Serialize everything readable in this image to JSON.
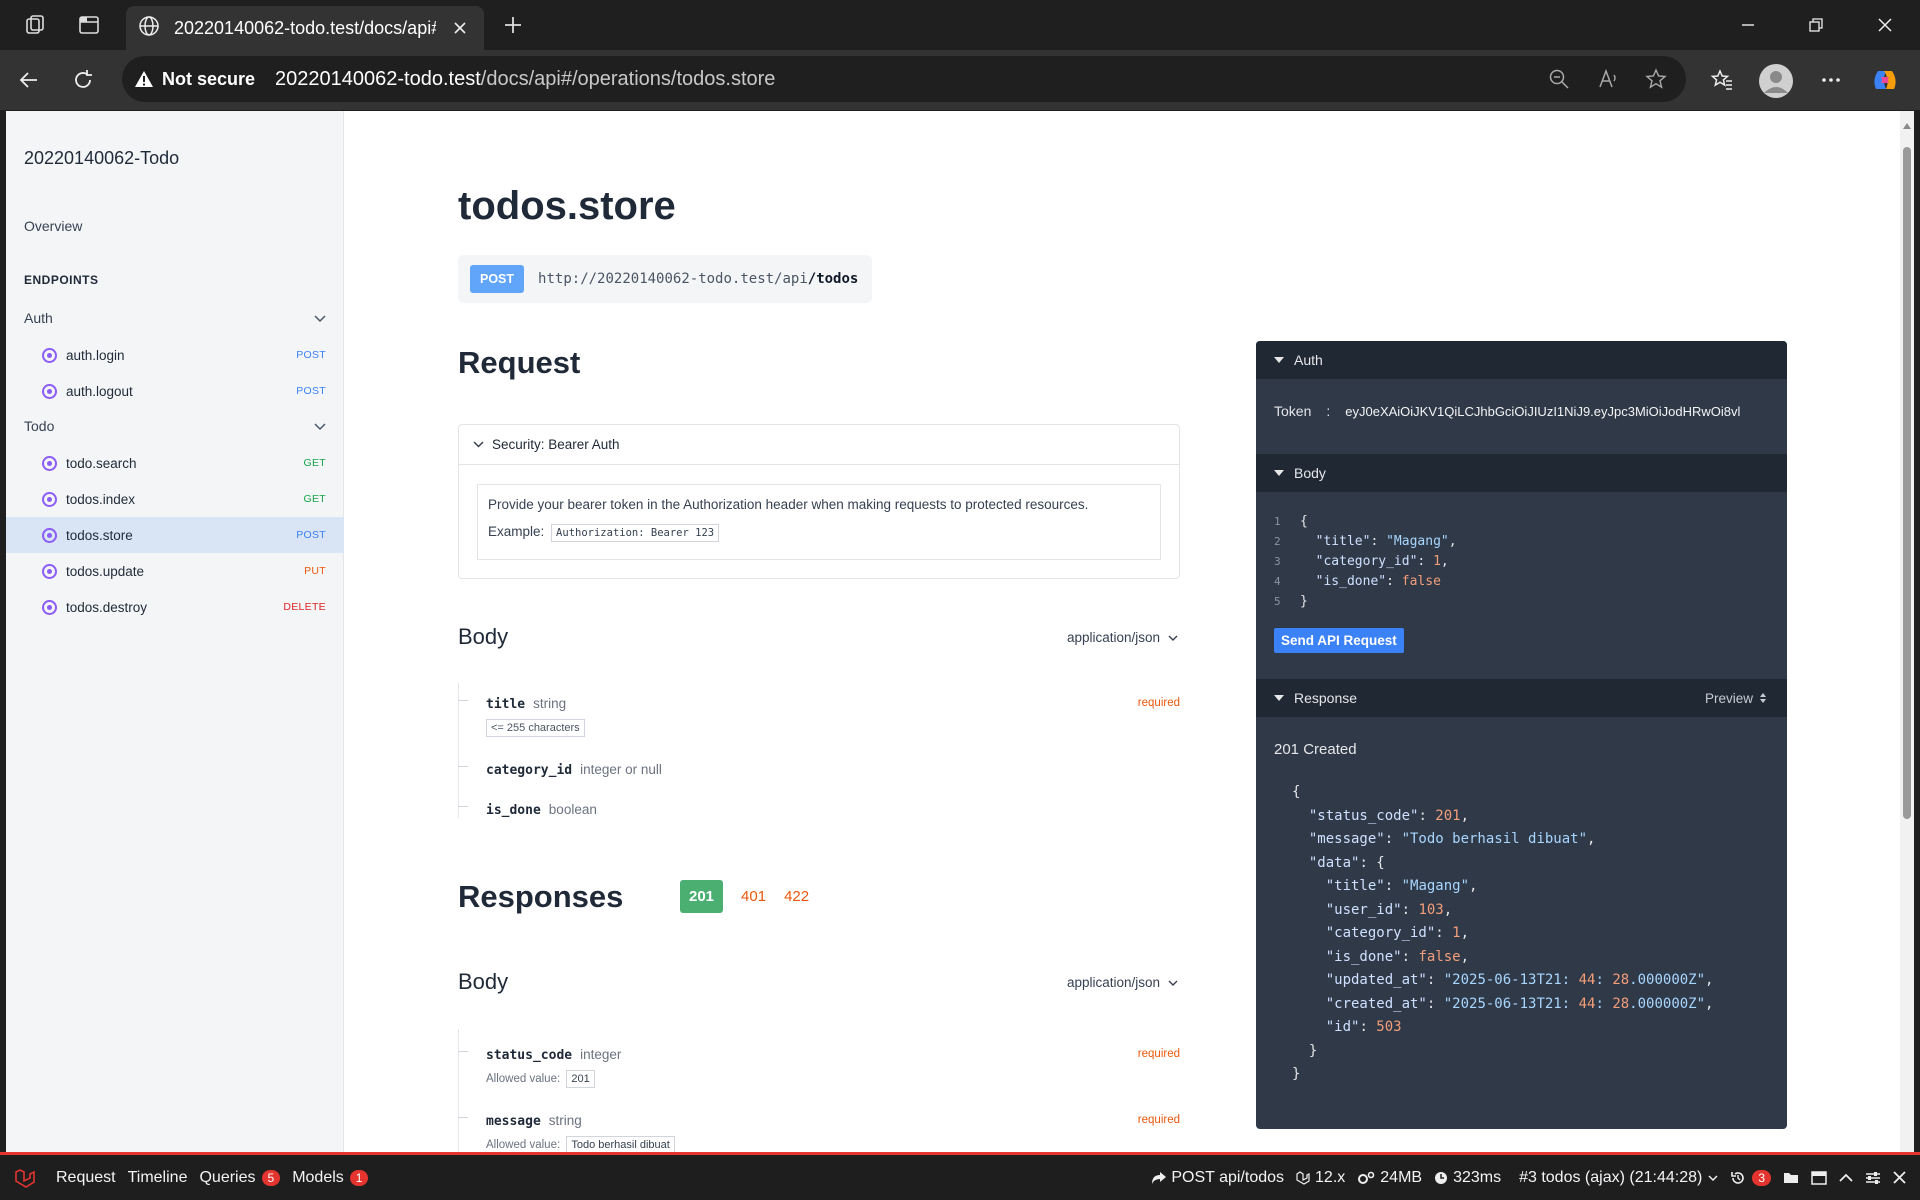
{
  "browser": {
    "tab_title": "20220140062-todo.test/docs/api#",
    "security_label": "Not secure",
    "url_host": "20220140062-todo.test",
    "url_path": "/docs/api#/operations/todos.store"
  },
  "sidebar": {
    "brand": "20220140062-Todo",
    "overview": "Overview",
    "section_label": "ENDPOINTS",
    "groups": [
      {
        "label": "Auth"
      },
      {
        "label": "Todo"
      }
    ],
    "endpoints": [
      {
        "label": "auth.login",
        "method": "POST"
      },
      {
        "label": "auth.logout",
        "method": "POST"
      },
      {
        "label": "todo.search",
        "method": "GET"
      },
      {
        "label": "todos.index",
        "method": "GET"
      },
      {
        "label": "todos.store",
        "method": "POST"
      },
      {
        "label": "todos.update",
        "method": "PUT"
      },
      {
        "label": "todos.destroy",
        "method": "DELETE"
      }
    ]
  },
  "main": {
    "title": "todos.store",
    "method": "POST",
    "url_base": "http://20220140062-todo.test/api",
    "url_path": "/todos",
    "request_heading": "Request",
    "security_title": "Security: Bearer Auth",
    "security_desc": "Provide your bearer token in the Authorization header when making requests to protected resources.",
    "example_label": "Example:",
    "example_value": "Authorization: Bearer 123",
    "body_heading": "Body",
    "content_type": "application/json",
    "request_fields": [
      {
        "name": "title",
        "type": "string",
        "required": "required",
        "constraint": "<= 255 characters"
      },
      {
        "name": "category_id",
        "type": "integer or null"
      },
      {
        "name": "is_done",
        "type": "boolean"
      }
    ],
    "responses_heading": "Responses",
    "response_codes": [
      "201",
      "401",
      "422"
    ],
    "response_body_heading": "Body",
    "response_content_type": "application/json",
    "response_fields": [
      {
        "name": "status_code",
        "type": "integer",
        "required": "required",
        "allowed_label": "Allowed value:",
        "allowed": "201"
      },
      {
        "name": "message",
        "type": "string",
        "required": "required",
        "allowed_label": "Allowed value:",
        "allowed": "Todo berhasil dibuat"
      }
    ]
  },
  "panel": {
    "auth_heading": "Auth",
    "token_label": "Token",
    "token_sep": ":",
    "token_value": "eyJ0eXAiOiJKV1QiLCJhbGciOiJIUzI1NiJ9.eyJpc3MiOiJodHRwOi8vl",
    "body_heading": "Body",
    "body_lines": [
      "{",
      "  \"title\": \"Magang\",",
      "  \"category_id\": 1,",
      "  \"is_done\": false",
      "}"
    ],
    "send_label": "Send API Request",
    "response_heading": "Response",
    "preview_label": "Preview",
    "status": "201 Created",
    "response_json": [
      "{",
      "  \"status_code\": 201,",
      "  \"message\": \"Todo berhasil dibuat\",",
      "  \"data\": {",
      "    \"title\": \"Magang\",",
      "    \"user_id\": 103,",
      "    \"category_id\": 1,",
      "    \"is_done\": false,",
      "    \"updated_at\": \"2025-06-13T21:44:28.000000Z\",",
      "    \"created_at\": \"2025-06-13T21:44:28.000000Z\",",
      "    \"id\": 503",
      "  }",
      "}"
    ]
  },
  "debugbar": {
    "request": "Request",
    "timeline": "Timeline",
    "queries": "Queries",
    "queries_count": "5",
    "models": "Models",
    "models_count": "1",
    "route": "POST api/todos",
    "version": "12.x",
    "memory": "24MB",
    "time": "323ms",
    "request_select": "#3 todos (ajax) (21:44:28)",
    "history_count": "3"
  }
}
